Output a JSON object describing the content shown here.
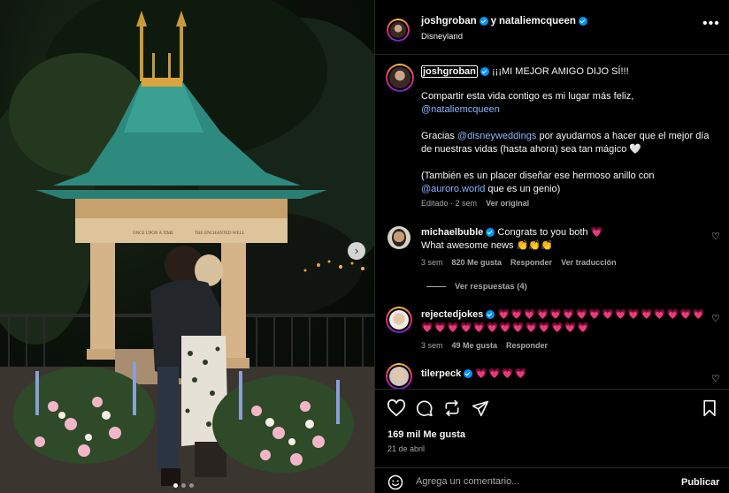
{
  "header": {
    "user1": "joshgroban",
    "joiner": "y",
    "user2": "nataliemcqueen",
    "location": "Disneyland"
  },
  "photo": {
    "sign_left": "ONCE UPON A TIME",
    "sign_right": "THE ENCHANTED WELL"
  },
  "caption": {
    "username": "joshgroban",
    "headline": "¡¡¡MI MEJOR AMIGO DIJO SÍ!!!",
    "p1_text": "Compartir esta vida contigo es mi lugar más feliz,",
    "p1_mention": "@nataliemcqueen",
    "p2_before": "Gracias ",
    "p2_mention": "@disneyweddings",
    "p2_after": " por ayudarnos a hacer que el mejor día de nuestras vidas (hasta ahora) sea tan mágico 🤍",
    "p3_text": "(También es un placer diseñar ese hermoso anillo con",
    "p3_mention": "@auroro.world",
    "p3_after": " que es un genio)",
    "edited": "Editado",
    "time": "· 2 sem",
    "view_original": "Ver original"
  },
  "comments": [
    {
      "username": "michaelbuble",
      "line1": "Congrats to you both 💗",
      "line2": "What awesome news 👏👏👏",
      "time": "3 sem",
      "likes": "820 Me gusta",
      "reply": "Responder",
      "translate": "Ver traducción"
    },
    {
      "username": "rejectedjokes",
      "text": "💗💗💗💗💗💗💗💗💗💗💗💗💗💗💗💗💗💗💗💗💗💗💗💗💗💗💗💗💗",
      "time": "3 sem",
      "likes": "49 Me gusta",
      "reply": "Responder"
    },
    {
      "username": "tilerpeck",
      "text": "💗💗💗💗"
    }
  ],
  "view_replies": "Ver respuestas (4)",
  "actions": {
    "likes": "169 mil Me gusta",
    "date": "21 de abril"
  },
  "comment_box": {
    "placeholder": "Agrega un comentario...",
    "publish": "Publicar"
  },
  "colors": {
    "verified": "#0095f6",
    "link": "#8ab4ff",
    "secondary_text": "#a8a8a8",
    "heart": "#ff3366"
  }
}
